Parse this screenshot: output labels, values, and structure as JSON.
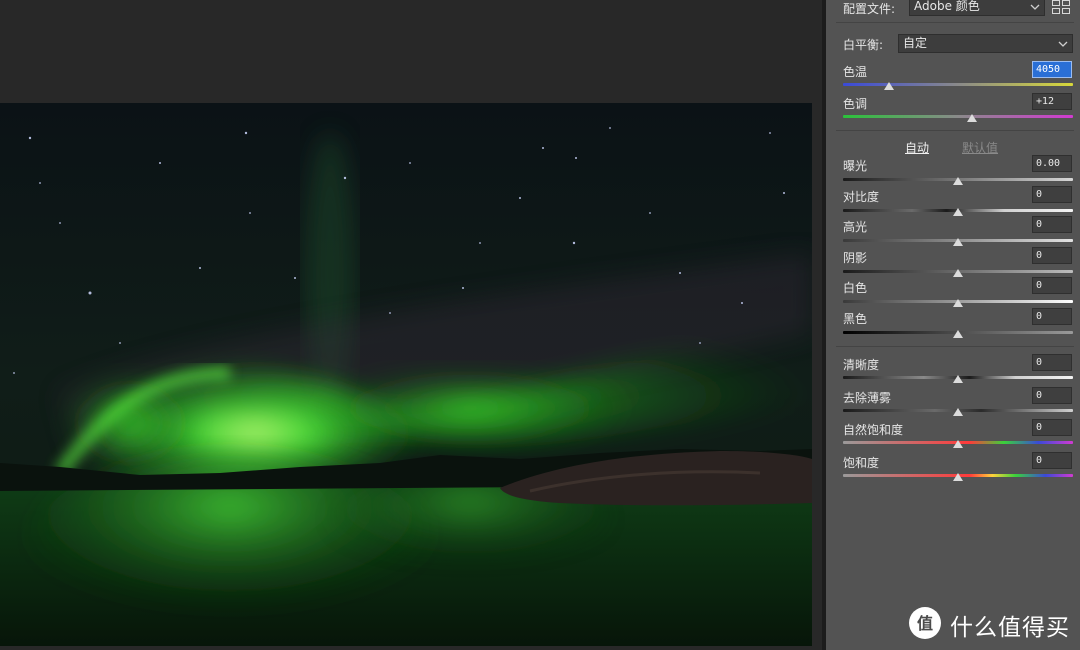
{
  "profile": {
    "label": "配置文件:",
    "value": "Adobe 颜色"
  },
  "white_balance": {
    "label": "白平衡:",
    "value": "自定"
  },
  "temperature": {
    "label": "色温",
    "value": "4050",
    "level": 0.2
  },
  "tint": {
    "label": "色调",
    "value": "+12",
    "level": 0.56
  },
  "auto_label": "自动",
  "default_label": "默认值",
  "tone_sliders": [
    {
      "label": "曝光",
      "value": "0.00",
      "level": 0.5
    },
    {
      "label": "对比度",
      "value": "0",
      "level": 0.5
    },
    {
      "label": "高光",
      "value": "0",
      "level": 0.5
    },
    {
      "label": "阴影",
      "value": "0",
      "level": 0.5
    },
    {
      "label": "白色",
      "value": "0",
      "level": 0.5
    },
    {
      "label": "黑色",
      "value": "0",
      "level": 0.5
    }
  ],
  "presence_sliders": [
    {
      "label": "清晰度",
      "value": "0",
      "level": 0.5
    },
    {
      "label": "去除薄雾",
      "value": "0",
      "level": 0.5
    },
    {
      "label": "自然饱和度",
      "value": "0",
      "level": 0.5
    },
    {
      "label": "饱和度",
      "value": "0",
      "level": 0.5
    }
  ],
  "watermark": {
    "text": "什么值得买",
    "logo_glyph": "值"
  },
  "icons": [
    "chevron-down-icon",
    "grid-icon"
  ],
  "colors": {
    "panel_bg": "#535353",
    "canvas_bg": "#282828",
    "selection": "#2a6fd6",
    "aurora": "#39e62a"
  }
}
